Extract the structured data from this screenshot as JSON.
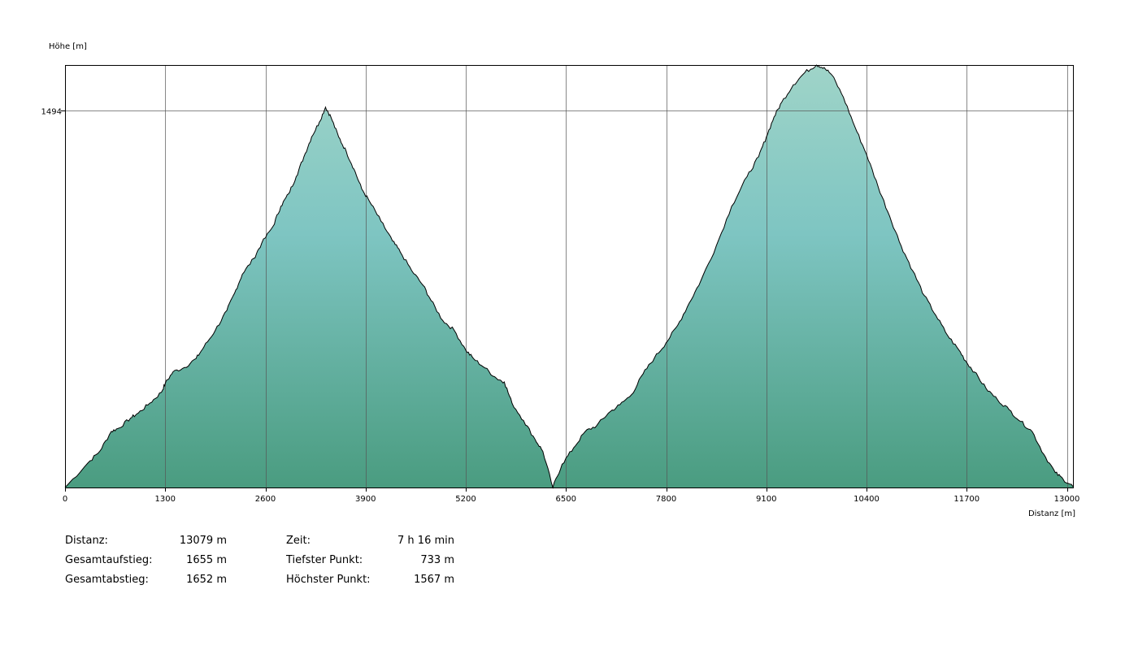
{
  "chart_data": {
    "type": "area",
    "title": "",
    "ylabel": "Höhe [m]",
    "xlabel": "Distanz [m]",
    "xlim": [
      0,
      13079
    ],
    "ylim": [
      733,
      1585
    ],
    "x_ticks": [
      0,
      1300,
      2600,
      3900,
      5200,
      6500,
      7800,
      9100,
      10400,
      11700,
      13000
    ],
    "y_ticks": [
      1494
    ],
    "grid": true,
    "fill_colors": {
      "top": "#9fd4c8",
      "middle": "#7ec5c2",
      "bottom": "#4a9c80"
    },
    "line_color": "#000000",
    "x": [
      0,
      300,
      450,
      600,
      700,
      850,
      950,
      1100,
      1250,
      1300,
      1400,
      1550,
      1700,
      1800,
      1950,
      2100,
      2200,
      2300,
      2450,
      2550,
      2700,
      2800,
      2900,
      3000,
      3100,
      3200,
      3300,
      3380,
      3450,
      3550,
      3650,
      3750,
      3850,
      3950,
      4100,
      4250,
      4350,
      4500,
      4650,
      4750,
      4900,
      5050,
      5200,
      5300,
      5450,
      5600,
      5700,
      5800,
      5950,
      6100,
      6200,
      6330,
      6450,
      6600,
      6750,
      6900,
      7050,
      7200,
      7350,
      7500,
      7650,
      7800,
      7950,
      8100,
      8250,
      8450,
      8650,
      8850,
      9000,
      9100,
      9200,
      9300,
      9450,
      9600,
      9750,
      9850,
      9950,
      10100,
      10250,
      10400,
      10550,
      10700,
      10850,
      11000,
      11150,
      11300,
      11450,
      11600,
      11700,
      11800,
      11950,
      12100,
      12250,
      12400,
      12550,
      12700,
      12850,
      12950,
      13079
    ],
    "y": [
      733,
      783,
      806,
      846,
      853,
      873,
      883,
      903,
      925,
      943,
      966,
      975,
      993,
      1016,
      1050,
      1090,
      1125,
      1163,
      1195,
      1225,
      1260,
      1300,
      1325,
      1360,
      1400,
      1440,
      1470,
      1500,
      1480,
      1440,
      1410,
      1375,
      1335,
      1310,
      1270,
      1230,
      1208,
      1170,
      1140,
      1110,
      1070,
      1050,
      1010,
      993,
      974,
      953,
      946,
      903,
      868,
      830,
      806,
      733,
      780,
      813,
      846,
      858,
      883,
      900,
      920,
      962,
      995,
      1025,
      1060,
      1105,
      1150,
      1220,
      1300,
      1360,
      1400,
      1440,
      1480,
      1510,
      1545,
      1570,
      1585,
      1580,
      1565,
      1520,
      1460,
      1405,
      1340,
      1280,
      1220,
      1170,
      1120,
      1080,
      1040,
      1010,
      985,
      966,
      933,
      910,
      890,
      866,
      846,
      800,
      763,
      750,
      735
    ]
  },
  "stats": {
    "left": [
      {
        "label": "Distanz:",
        "value": "13079 m"
      },
      {
        "label": "Gesamtaufstieg:",
        "value": "1655 m"
      },
      {
        "label": "Gesamtabstieg:",
        "value": "1652 m"
      }
    ],
    "right": [
      {
        "label": "Zeit:",
        "value": "7 h 16 min"
      },
      {
        "label": "Tiefster Punkt:",
        "value": "733 m"
      },
      {
        "label": "Höchster Punkt:",
        "value": "1567 m"
      }
    ]
  }
}
